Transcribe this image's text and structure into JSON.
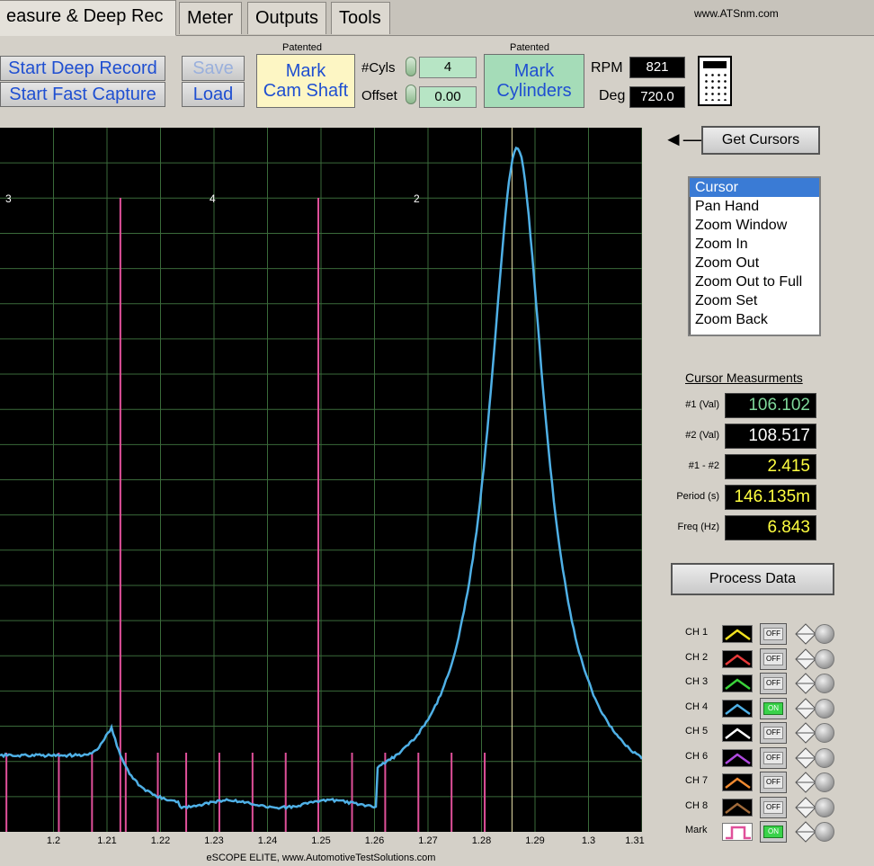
{
  "tabs": [
    {
      "label": "easure & Deep Rec",
      "active": true
    },
    {
      "label": "Meter",
      "active": false
    },
    {
      "label": "Outputs",
      "active": false
    },
    {
      "label": "Tools",
      "active": false
    }
  ],
  "site_url": "www.ATSnm.com",
  "toolbar": {
    "start_deep_record": "Start Deep Record",
    "start_fast_capture": "Start Fast Capture",
    "save": "Save",
    "load": "Load",
    "patented_1": "Patented",
    "mark_cam_line1": "Mark",
    "mark_cam_line2": "Cam Shaft",
    "cyls_label": "#Cyls",
    "cyls_value": "4",
    "offset_label": "Offset",
    "offset_value": "0.00",
    "patented_2": "Patented",
    "mark_cyl_line1": "Mark",
    "mark_cyl_line2": "Cylinders",
    "rpm_label": "RPM",
    "rpm_value": "821",
    "deg_label": "Deg",
    "deg_value": "720.0"
  },
  "scope": {
    "cylinder_labels": [
      "3",
      "4",
      "2"
    ],
    "footer": "eSCOPE ELITE, www.AutomotiveTestSolutions.com",
    "trace_color": "#4fb0e6",
    "marker_color": "#e0509a",
    "grid_color": "#3a6a3a"
  },
  "chart_data": {
    "type": "line",
    "x_ticks": [
      "1.2",
      "1.21",
      "1.22",
      "1.23",
      "1.24",
      "1.25",
      "1.26",
      "1.27",
      "1.28",
      "1.29",
      "1.3",
      "1.31"
    ],
    "xlim": [
      1.19,
      1.31
    ]
  },
  "right_panel": {
    "get_cursors": "Get Cursors",
    "cursor_modes": [
      "Cursor",
      "Pan Hand",
      "Zoom Window",
      "Zoom In",
      "Zoom Out",
      "Zoom Out to Full",
      "Zoom Set",
      "Zoom Back"
    ],
    "selected_mode": "Cursor",
    "measurements_title": "Cursor Measurments",
    "measurements": [
      {
        "label": "#1 (Val)",
        "value": "106.102",
        "color": "#7fd89a"
      },
      {
        "label": "#2 (Val)",
        "value": "108.517",
        "color": "#ffffff"
      },
      {
        "label": "#1 - #2",
        "value": "2.415",
        "color": "#ffff40"
      },
      {
        "label": "Period (s)",
        "value": "146.135m",
        "color": "#ffff40"
      },
      {
        "label": "Freq (Hz)",
        "value": "6.843",
        "color": "#ffff40"
      }
    ],
    "process_data": "Process Data",
    "channels": [
      {
        "label": "CH 1",
        "state": "OFF",
        "color": "#f0e020"
      },
      {
        "label": "CH 2",
        "state": "OFF",
        "color": "#e83a3a"
      },
      {
        "label": "CH 3",
        "state": "OFF",
        "color": "#3ad23a"
      },
      {
        "label": "CH 4",
        "state": "ON",
        "color": "#4fb0e6"
      },
      {
        "label": "CH 5",
        "state": "OFF",
        "color": "#ffffff"
      },
      {
        "label": "CH 6",
        "state": "OFF",
        "color": "#b04ae0"
      },
      {
        "label": "CH 7",
        "state": "OFF",
        "color": "#f08a30"
      },
      {
        "label": "CH 8",
        "state": "OFF",
        "color": "#a06a3a"
      },
      {
        "label": "Mark",
        "state": "ON",
        "color": "#e0509a"
      }
    ]
  }
}
